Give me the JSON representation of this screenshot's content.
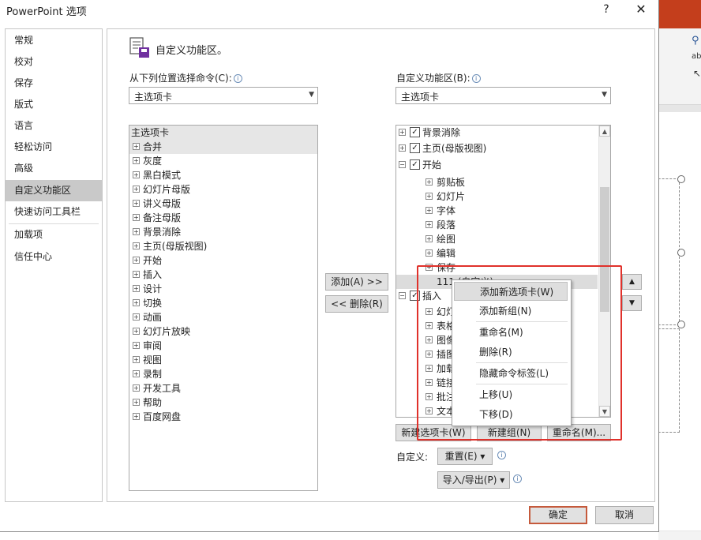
{
  "dialog": {
    "title": "PowerPoint 选项",
    "help": "?",
    "close": "✕"
  },
  "nav": {
    "items": [
      {
        "label": "常规"
      },
      {
        "label": "校对"
      },
      {
        "label": "保存"
      },
      {
        "label": "版式"
      },
      {
        "label": "语言"
      },
      {
        "label": "轻松访问"
      },
      {
        "label": "高级"
      },
      {
        "label": "自定义功能区"
      },
      {
        "label": "快速访问工具栏"
      },
      {
        "label": "加载项"
      },
      {
        "label": "信任中心"
      }
    ],
    "selected": "自定义功能区"
  },
  "header": {
    "title": "自定义功能区。"
  },
  "left": {
    "label": "从下列位置选择命令(C):",
    "combo": "主选项卡",
    "list_header": "主选项卡",
    "items": [
      "合并",
      "灰度",
      "黑白模式",
      "幻灯片母版",
      "讲义母版",
      "备注母版",
      "背景消除",
      "主页(母版视图)",
      "开始",
      "插入",
      "设计",
      "切换",
      "动画",
      "幻灯片放映",
      "审阅",
      "视图",
      "录制",
      "开发工具",
      "帮助",
      "百度网盘"
    ]
  },
  "middle": {
    "add": "添加(A) >>",
    "remove": "<< 删除(R)"
  },
  "right": {
    "label": "自定义功能区(B):",
    "combo": "主选项卡",
    "tree": {
      "bg_removal": "背景消除",
      "home_master": "主页(母版视图)",
      "home": "开始",
      "clipboard": "剪贴板",
      "slides": "幻灯片",
      "font": "字体",
      "paragraph": "段落",
      "drawing": "绘图",
      "editing": "编辑",
      "save": "保存",
      "custom_tab": "111 (自定义)",
      "insert": "插入",
      "insert_children": [
        "幻灯",
        "表格",
        "图像",
        "插图",
        "加载",
        "链接",
        "批注",
        "文本"
      ]
    },
    "new_tab": "新建选项卡(W)",
    "new_group": "新建组(N)",
    "rename": "重命名(M)...",
    "customize_label": "自定义:",
    "reset": "重置(E) ▾",
    "import_export": "导入/导出(P) ▾"
  },
  "context_menu": {
    "items": [
      "添加新选项卡(W)",
      "添加新组(N)",
      "重命名(M)",
      "删除(R)",
      "隐藏命令标签(L)",
      "上移(U)",
      "下移(D)"
    ]
  },
  "footer": {
    "ok": "确定",
    "cancel": "取消"
  }
}
